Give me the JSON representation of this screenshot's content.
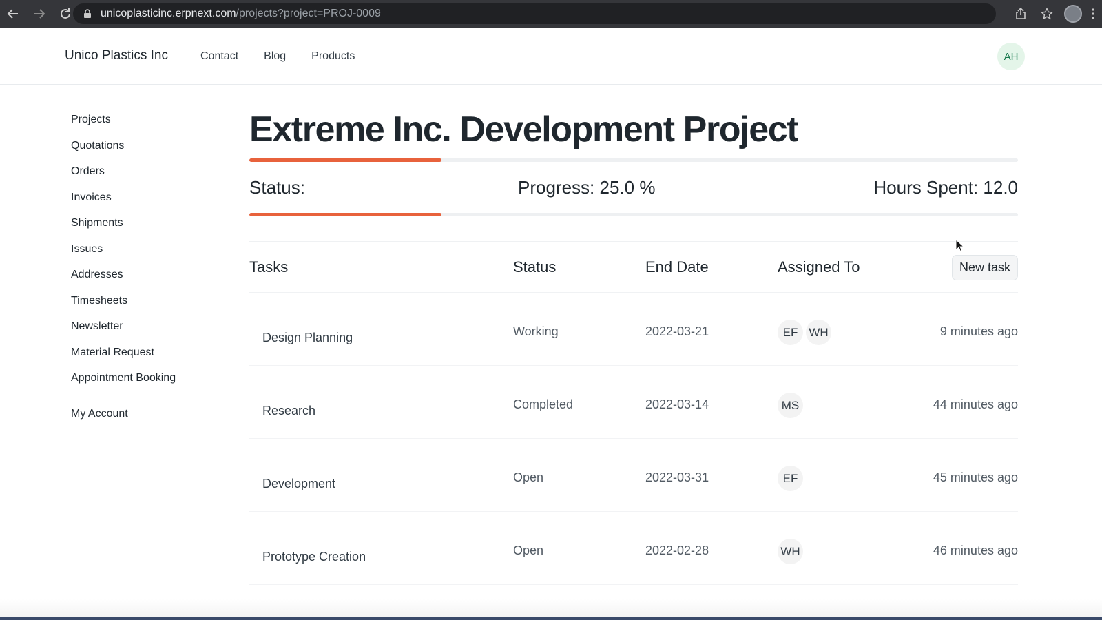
{
  "browser": {
    "url_host": "unicoplasticinc.erpnext.com",
    "url_path": "/projects?project=PROJ-0009"
  },
  "header": {
    "brand": "Unico Plastics Inc",
    "nav": [
      "Contact",
      "Blog",
      "Products"
    ],
    "avatar_initials": "AH"
  },
  "sidebar": {
    "items": [
      "Projects",
      "Quotations",
      "Orders",
      "Invoices",
      "Shipments",
      "Issues",
      "Addresses",
      "Timesheets",
      "Newsletter",
      "Material Request",
      "Appointment Booking"
    ],
    "account": "My Account"
  },
  "project": {
    "title": "Extreme Inc. Development Project",
    "status_label": "Status:",
    "progress_label": "Progress: 25.0 %",
    "progress_fraction": 0.25,
    "hours_label": "Hours Spent: 12.0"
  },
  "tasks": {
    "headers": {
      "tasks": "Tasks",
      "status": "Status",
      "end_date": "End Date",
      "assigned_to": "Assigned To"
    },
    "new_task_label": "New task",
    "rows": [
      {
        "name": "Design Planning",
        "status": "Working",
        "end_date": "2022-03-21",
        "assignees": [
          "EF",
          "WH"
        ],
        "modified": "9 minutes ago"
      },
      {
        "name": "Research",
        "status": "Completed",
        "end_date": "2022-03-14",
        "assignees": [
          "MS"
        ],
        "modified": "44 minutes ago"
      },
      {
        "name": "Development",
        "status": "Open",
        "end_date": "2022-03-31",
        "assignees": [
          "EF"
        ],
        "modified": "45 minutes ago"
      },
      {
        "name": "Prototype Creation",
        "status": "Open",
        "end_date": "2022-02-28",
        "assignees": [
          "WH"
        ],
        "modified": "46 minutes ago"
      }
    ]
  },
  "colors": {
    "progress_fill": "#e8623c",
    "avatar_bg": "#e4f5e9",
    "avatar_text": "#16794c"
  },
  "icons": {
    "back": "arrow-left-icon",
    "forward": "arrow-right-icon",
    "reload": "reload-icon",
    "lock": "lock-icon",
    "share": "share-icon",
    "bookmark": "star-icon",
    "menu": "kebab-menu-icon"
  }
}
